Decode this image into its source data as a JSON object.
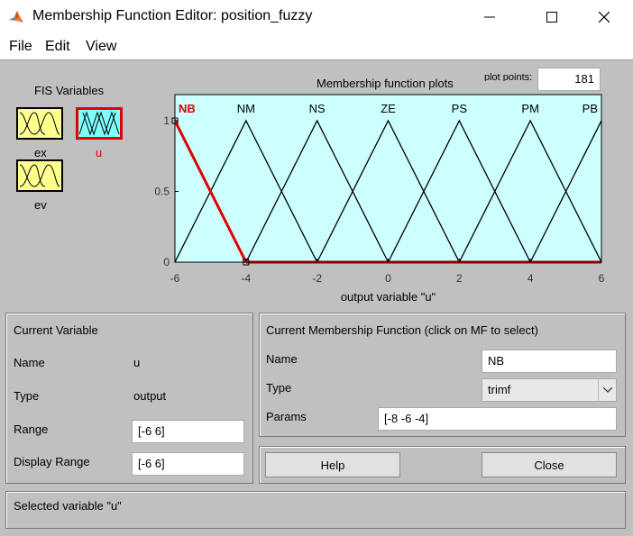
{
  "window": {
    "title": "Membership Function Editor: position_fuzzy",
    "minimize_icon": "minimize-icon",
    "maximize_icon": "maximize-icon",
    "close_icon": "close-icon",
    "app_icon": "matlab-icon"
  },
  "menu": {
    "items": [
      "File",
      "Edit",
      "View"
    ]
  },
  "fis_variables": {
    "heading": "FIS Variables",
    "inputs": [
      {
        "name": "ex"
      },
      {
        "name": "ev"
      }
    ],
    "outputs": [
      {
        "name": "u"
      }
    ],
    "selected": "u",
    "colors": {
      "input": "#ffff90",
      "output": "#7fffff",
      "selected_border": "#e00000"
    }
  },
  "plot": {
    "title": "Membership function plots",
    "plot_points_label": "plot points:",
    "plot_points_value": "181",
    "xlabel": "output variable \"u\"",
    "background": "#ccffff",
    "selected_color": "#e00000"
  },
  "chart_data": {
    "type": "line",
    "xlim": [
      -6,
      6
    ],
    "ylim": [
      0,
      1
    ],
    "xticks": [
      "-6",
      "-4",
      "-2",
      "0",
      "2",
      "4",
      "6"
    ],
    "yticks": [
      "0",
      "0.5",
      "1"
    ],
    "series": [
      {
        "name": "NB",
        "points": [
          [
            -8,
            0
          ],
          [
            -6,
            1
          ],
          [
            -4,
            0
          ]
        ],
        "selected": true
      },
      {
        "name": "NM",
        "points": [
          [
            -6,
            0
          ],
          [
            -4,
            1
          ],
          [
            -2,
            0
          ]
        ]
      },
      {
        "name": "NS",
        "points": [
          [
            -4,
            0
          ],
          [
            -2,
            1
          ],
          [
            0,
            0
          ]
        ]
      },
      {
        "name": "ZE",
        "points": [
          [
            -2,
            0
          ],
          [
            0,
            1
          ],
          [
            2,
            0
          ]
        ]
      },
      {
        "name": "PS",
        "points": [
          [
            0,
            0
          ],
          [
            2,
            1
          ],
          [
            4,
            0
          ]
        ]
      },
      {
        "name": "PM",
        "points": [
          [
            2,
            0
          ],
          [
            4,
            1
          ],
          [
            6,
            0
          ]
        ]
      },
      {
        "name": "PB",
        "points": [
          [
            4,
            0
          ],
          [
            6,
            1
          ],
          [
            8,
            0
          ]
        ]
      }
    ]
  },
  "current_variable": {
    "heading": "Current Variable",
    "name_label": "Name",
    "name_value": "u",
    "type_label": "Type",
    "type_value": "output",
    "range_label": "Range",
    "range_value": "[-6 6]",
    "display_range_label": "Display Range",
    "display_range_value": "[-6 6]"
  },
  "current_mf": {
    "heading": "Current Membership Function (click on MF to select)",
    "name_label": "Name",
    "name_value": "NB",
    "type_label": "Type",
    "type_value": "trimf",
    "params_label": "Params",
    "params_value": "[-8 -6 -4]"
  },
  "buttons": {
    "help": "Help",
    "close": "Close"
  },
  "status": {
    "text": "Selected variable \"u\""
  }
}
